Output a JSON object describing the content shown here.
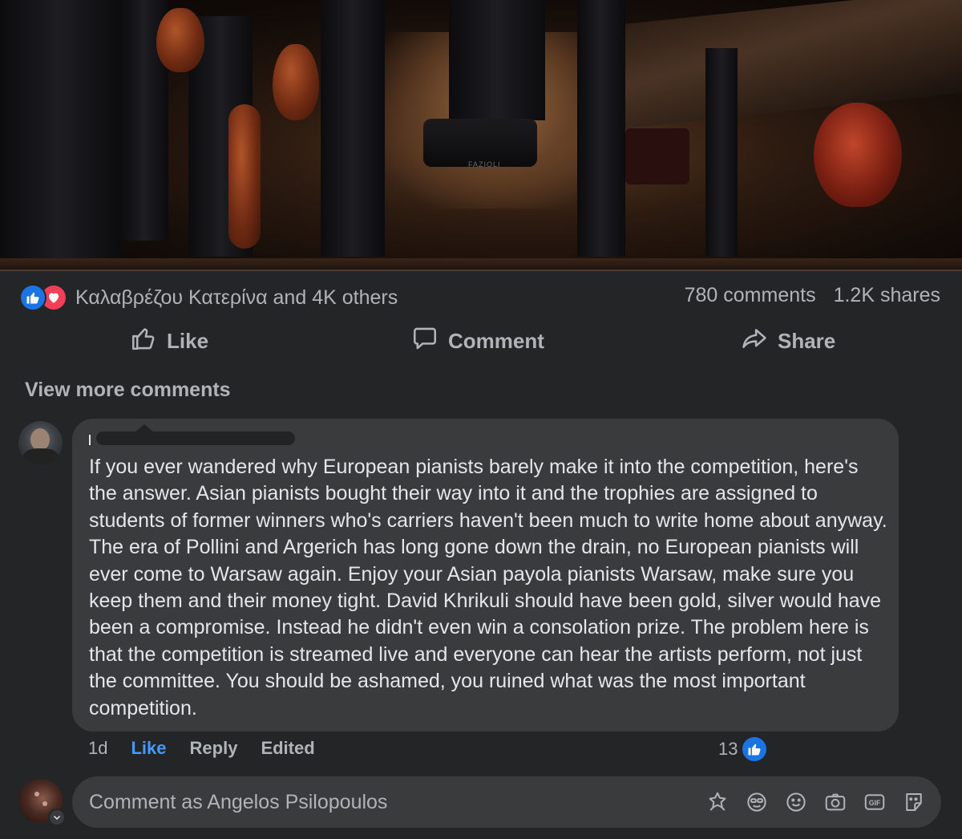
{
  "post": {
    "reactions": {
      "icons": [
        "like-icon",
        "love-icon"
      ],
      "summary": "Καλαβρέζου Κατερίνα and 4K others"
    },
    "stats": {
      "comments": "780 comments",
      "shares": "1.2K shares"
    },
    "actions": {
      "like": "Like",
      "comment": "Comment",
      "share": "Share"
    },
    "photo": {
      "bench_label": "FAZIOLI"
    }
  },
  "comments": {
    "view_more": "View more comments",
    "items": [
      {
        "author_initial": "",
        "text": "If you ever wandered why European pianists barely make it into the competition, here's the answer. Asian pianists bought their way into it and the trophies are assigned to students of former winners who's carriers haven't been much to write home about anyway. The era of Pollini and Argerich has long gone down the drain, no European pianists will ever come to Warsaw again. Enjoy your Asian payola pianists Warsaw, make sure you keep them and their money tight. David Khrikuli should have been gold, silver would have been a compromise. Instead he didn't even win a consolation prize. The problem here is that the competition is streamed live and everyone can hear the artists perform, not just the committee. You should be ashamed, you ruined what was the most important competition.",
        "time": "1d",
        "like_label": "Like",
        "reply_label": "Reply",
        "edited_label": "Edited",
        "like_count": "13"
      }
    ]
  },
  "composer": {
    "placeholder": "Comment as Angelos Psilopoulos",
    "tools": [
      "avatar-sticker-icon",
      "emoji-face-icon",
      "smiley-icon",
      "camera-icon",
      "gif-icon",
      "sticker-icon"
    ]
  },
  "colors": {
    "background": "#242526",
    "bubble": "#3a3b3c",
    "text_primary": "#e4e6eb",
    "text_secondary": "#b0b3b8",
    "like_blue": "#1b74e4",
    "like_text_blue": "#4599ff",
    "love_red": "#f33e58"
  }
}
